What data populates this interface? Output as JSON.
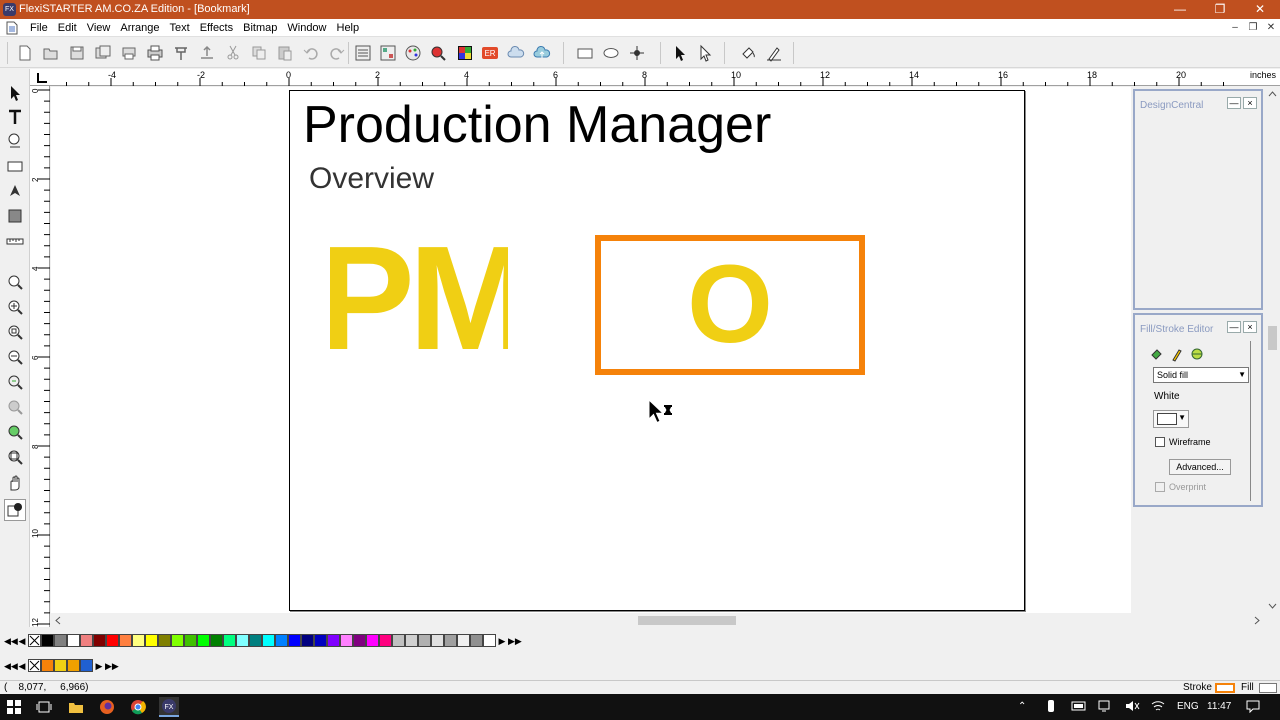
{
  "window": {
    "title": "FlexiSTARTER AM.CO.ZA Edition - [Bookmark]",
    "app_icon_text": "FX",
    "controls": [
      "—",
      "❐",
      "✕"
    ]
  },
  "menubar": {
    "items": [
      "File",
      "Edit",
      "View",
      "Arrange",
      "Text",
      "Effects",
      "Bitmap",
      "Window",
      "Help"
    ],
    "mdi_controls": [
      "–",
      "❐",
      "✕"
    ]
  },
  "toolbar": {
    "icons": [
      "new-icon",
      "open-icon",
      "save-icon",
      "save-as-icon",
      "print-setup-icon",
      "print-icon",
      "cut-path-icon",
      "send-icon",
      "cut-icon",
      "copy-icon",
      "paste-icon",
      "undo-icon",
      "redo-icon",
      "import-icon",
      "export-icon",
      "color-wheel-icon",
      "zoom-color-icon",
      "swatch-grid-icon",
      "er-icon",
      "cloud-icon",
      "cloud-upload-icon",
      "rectangle-icon",
      "ellipse-icon",
      "node-icon",
      "select-icon",
      "node-select-icon",
      "fill-icon",
      "stroke-icon"
    ],
    "er_label": "ER"
  },
  "ruler": {
    "unit": "inches",
    "h_labels": [
      "4",
      "2",
      "0",
      "2",
      "4",
      "6",
      "8",
      "10",
      "12",
      "14",
      "16",
      "18",
      "20"
    ],
    "v_labels": [
      "0",
      "2",
      "4",
      "6",
      "8",
      "10",
      "12"
    ]
  },
  "document": {
    "title": "Production Manager",
    "subtitle": "Overview",
    "logo_text": "PM",
    "box_letter": "O",
    "colors": {
      "yellow": "#f0cf14",
      "orange": "#f5820a"
    }
  },
  "design_central": {
    "title": "DesignCentral"
  },
  "fill_stroke_editor": {
    "title": "Fill/Stroke Editor",
    "fill_type": "Solid fill",
    "color_name": "White",
    "wireframe_label": "Wireframe",
    "advanced_label": "Advanced...",
    "overprint_label": "Overprint"
  },
  "palette": {
    "colors": [
      "#000000",
      "#808080",
      "#ffffff",
      "#f08080",
      "#800000",
      "#ff0000",
      "#ff8040",
      "#ffff80",
      "#ffff00",
      "#808000",
      "#80ff00",
      "#40c000",
      "#00ff00",
      "#008000",
      "#00ff80",
      "#80ffff",
      "#008080",
      "#00ffff",
      "#0080ff",
      "#0000ff",
      "#000080",
      "#0000c0",
      "#8000ff",
      "#ff80ff",
      "#800080",
      "#ff00ff",
      "#ff0080",
      "#c0c0c0",
      "#d0d0d0",
      "#b0b0b0",
      "#e0e0e0",
      "#a0a0a0",
      "#f0f0f0",
      "#909090",
      "#ffffff"
    ],
    "doc_colors": [
      "#f5820a",
      "#f0cf14",
      "#f0a000",
      "#2060d0"
    ]
  },
  "statusbar": {
    "coords": "(    8,077,     6,966)",
    "stroke_label": "Stroke",
    "fill_label": "Fill"
  },
  "taskbar": {
    "lang": "ENG",
    "time": "11:47"
  }
}
